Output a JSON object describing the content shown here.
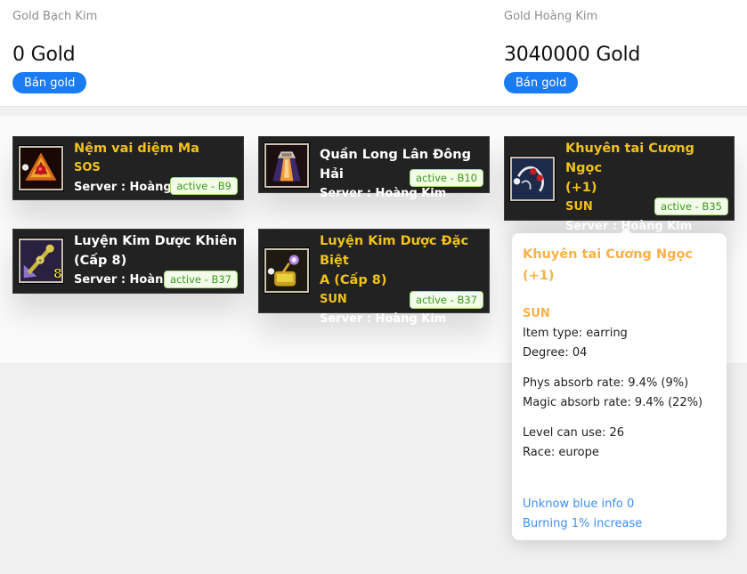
{
  "gold": [
    {
      "label": "Gold Bạch Kim",
      "value": "0 Gold",
      "button": "Bán gold"
    },
    {
      "label": "Gold Hoàng Kim",
      "value": "3040000 Gold",
      "button": "Bán gold"
    }
  ],
  "items": [
    {
      "name": "Nệm vai diệm Ma",
      "name_line2": "",
      "owner": "SOS",
      "server": "Server : Hoàng Kim",
      "badge": "active - B9",
      "name_color": "gold",
      "icon": "shoulder-pad-icon"
    },
    {
      "name": "Quần Long Lân Đông Hải",
      "name_line2": "",
      "owner": "",
      "server": "Server : Hoàng Kim",
      "badge": "active - B10",
      "name_color": "white",
      "icon": "robe-icon"
    },
    {
      "name": "Khuyên tai Cương Ngọc",
      "name_line2": "(+1)",
      "owner": "SUN",
      "server": "Server : Hoàng Kim",
      "badge": "active - B35",
      "name_color": "gold",
      "icon": "earring-icon"
    },
    {
      "name": "Luyện Kim Dược Khiên",
      "name_line2": "(Cấp 8)",
      "owner": "",
      "server": "Server : Hoàng Kim",
      "badge": "active - B37",
      "name_color": "white",
      "icon": "shield-elixir-icon"
    },
    {
      "name": "Luyện Kim Dược Đặc Biệt",
      "name_line2": "A (Cấp 8)",
      "owner": "SUN",
      "server": "Server : Hoàng Kim",
      "badge": "active - B37",
      "name_color": "gold",
      "icon": "special-elixir-icon"
    }
  ],
  "tooltip": {
    "title": "Khuyên tai Cương Ngọc (+1)",
    "owner": "SUN",
    "item_type": "Item type: earring",
    "degree": "Degree: 04",
    "phys_absorb": "Phys absorb rate: 9.4% (9%)",
    "magic_absorb": "Magic absorb rate: 9.4% (22%)",
    "level": "Level can use: 26",
    "race": "Race: europe",
    "blue_info": "Unknow blue info 0",
    "burning": "Burning 1% increase"
  },
  "colors": {
    "accent_blue": "#1a7cf5",
    "item_gold": "#f0c11c",
    "badge_green": "#3c9a1f",
    "tooltip_orange": "#f7b24a",
    "tooltip_blue": "#3d8ff2"
  }
}
